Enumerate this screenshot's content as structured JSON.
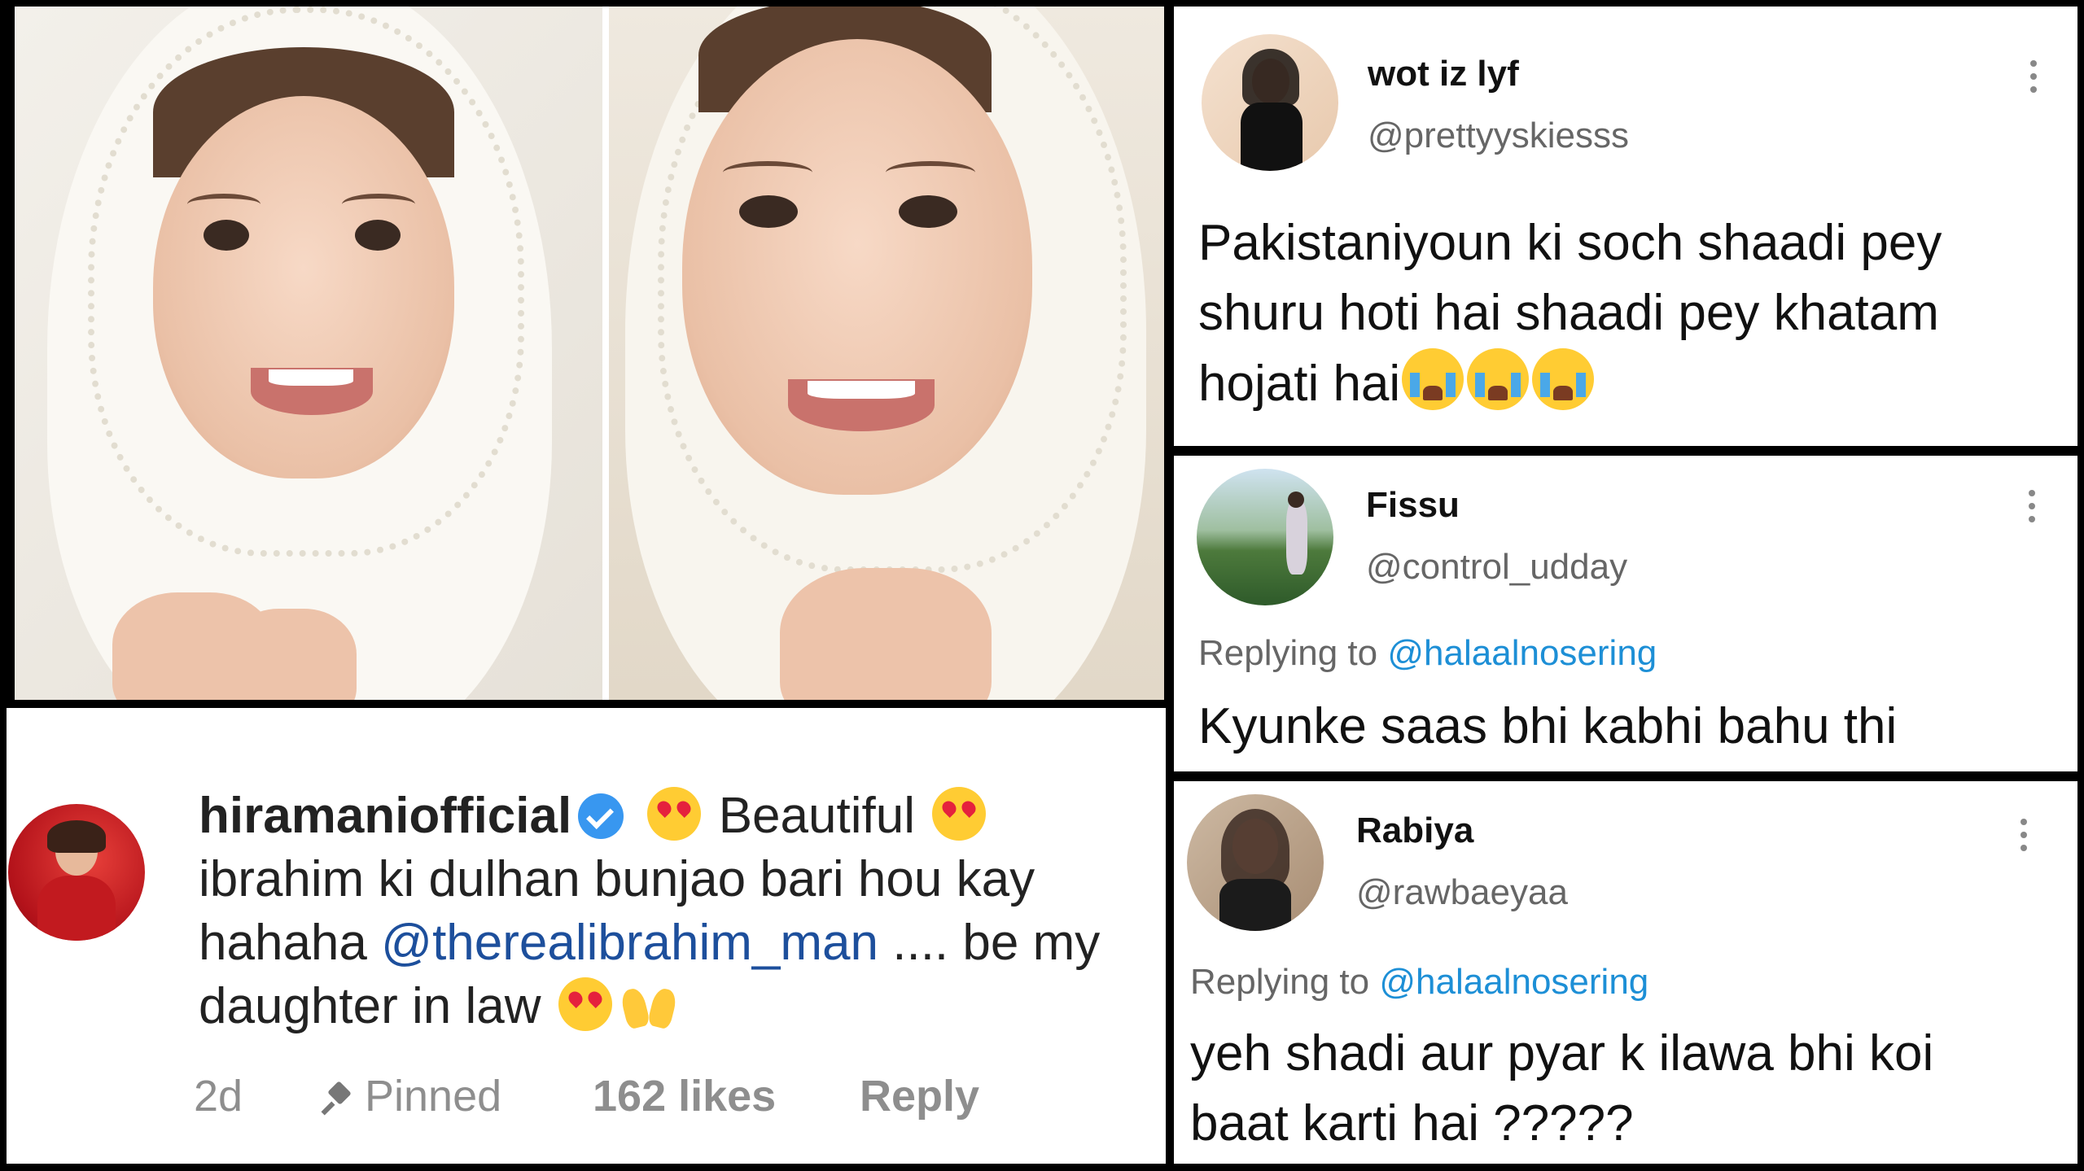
{
  "tweets": [
    {
      "name": "wot iz lyf",
      "handle": "@prettyyskiesss",
      "text": "Pakistaniyoun ki soch shaadi pey shuru hoti hai shaadi pey khatam hojati hai",
      "emoji": "loudly-crying-face-icon"
    },
    {
      "name": "Fissu",
      "handle": "@control_udday",
      "reply_prefix": "Replying to",
      "reply_to": "@halaalnosering",
      "text": "Kyunke saas bhi kabhi bahu thi"
    },
    {
      "name": "Rabiya",
      "handle": "@rawbaeyaa",
      "reply_prefix": "Replying to",
      "reply_to": "@halaalnosering",
      "text_line1": "yeh shadi aur pyar k ilawa bhi koi",
      "text_line2": "baat karti hai ?????"
    }
  ],
  "instagram": {
    "username": "hiramaniofficial",
    "text_part1": "Beautiful",
    "text_part2": "ibrahim ki dulhan bunjao bari hou kay hahaha",
    "mention": "@therealibrahim_man",
    "text_part3": ".... be my daughter in law",
    "time": "2d",
    "pinned": "Pinned",
    "likes": "162 likes",
    "reply": "Reply"
  },
  "colors": {
    "mention_blue": "#1d8fd6",
    "ig_link": "#1d4f9c",
    "verified": "#3897f0",
    "muted": "#8e8e8e"
  }
}
